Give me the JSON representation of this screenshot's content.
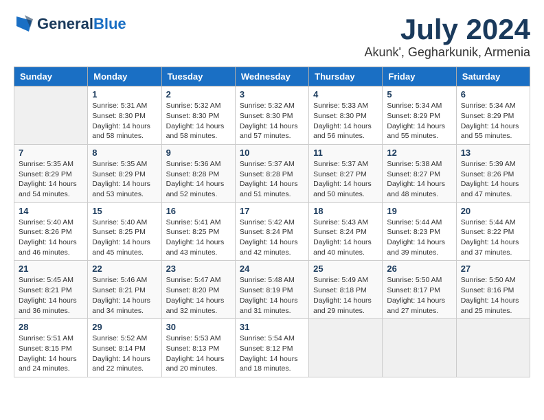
{
  "header": {
    "logo_general": "General",
    "logo_blue": "Blue",
    "month": "July 2024",
    "location": "Akunk', Gegharkunik, Armenia"
  },
  "weekdays": [
    "Sunday",
    "Monday",
    "Tuesday",
    "Wednesday",
    "Thursday",
    "Friday",
    "Saturday"
  ],
  "weeks": [
    [
      {
        "day": "",
        "sunrise": "",
        "sunset": "",
        "daylight": ""
      },
      {
        "day": "1",
        "sunrise": "Sunrise: 5:31 AM",
        "sunset": "Sunset: 8:30 PM",
        "daylight": "Daylight: 14 hours and 58 minutes."
      },
      {
        "day": "2",
        "sunrise": "Sunrise: 5:32 AM",
        "sunset": "Sunset: 8:30 PM",
        "daylight": "Daylight: 14 hours and 58 minutes."
      },
      {
        "day": "3",
        "sunrise": "Sunrise: 5:32 AM",
        "sunset": "Sunset: 8:30 PM",
        "daylight": "Daylight: 14 hours and 57 minutes."
      },
      {
        "day": "4",
        "sunrise": "Sunrise: 5:33 AM",
        "sunset": "Sunset: 8:30 PM",
        "daylight": "Daylight: 14 hours and 56 minutes."
      },
      {
        "day": "5",
        "sunrise": "Sunrise: 5:34 AM",
        "sunset": "Sunset: 8:29 PM",
        "daylight": "Daylight: 14 hours and 55 minutes."
      },
      {
        "day": "6",
        "sunrise": "Sunrise: 5:34 AM",
        "sunset": "Sunset: 8:29 PM",
        "daylight": "Daylight: 14 hours and 55 minutes."
      }
    ],
    [
      {
        "day": "7",
        "sunrise": "Sunrise: 5:35 AM",
        "sunset": "Sunset: 8:29 PM",
        "daylight": "Daylight: 14 hours and 54 minutes."
      },
      {
        "day": "8",
        "sunrise": "Sunrise: 5:35 AM",
        "sunset": "Sunset: 8:29 PM",
        "daylight": "Daylight: 14 hours and 53 minutes."
      },
      {
        "day": "9",
        "sunrise": "Sunrise: 5:36 AM",
        "sunset": "Sunset: 8:28 PM",
        "daylight": "Daylight: 14 hours and 52 minutes."
      },
      {
        "day": "10",
        "sunrise": "Sunrise: 5:37 AM",
        "sunset": "Sunset: 8:28 PM",
        "daylight": "Daylight: 14 hours and 51 minutes."
      },
      {
        "day": "11",
        "sunrise": "Sunrise: 5:37 AM",
        "sunset": "Sunset: 8:27 PM",
        "daylight": "Daylight: 14 hours and 50 minutes."
      },
      {
        "day": "12",
        "sunrise": "Sunrise: 5:38 AM",
        "sunset": "Sunset: 8:27 PM",
        "daylight": "Daylight: 14 hours and 48 minutes."
      },
      {
        "day": "13",
        "sunrise": "Sunrise: 5:39 AM",
        "sunset": "Sunset: 8:26 PM",
        "daylight": "Daylight: 14 hours and 47 minutes."
      }
    ],
    [
      {
        "day": "14",
        "sunrise": "Sunrise: 5:40 AM",
        "sunset": "Sunset: 8:26 PM",
        "daylight": "Daylight: 14 hours and 46 minutes."
      },
      {
        "day": "15",
        "sunrise": "Sunrise: 5:40 AM",
        "sunset": "Sunset: 8:25 PM",
        "daylight": "Daylight: 14 hours and 45 minutes."
      },
      {
        "day": "16",
        "sunrise": "Sunrise: 5:41 AM",
        "sunset": "Sunset: 8:25 PM",
        "daylight": "Daylight: 14 hours and 43 minutes."
      },
      {
        "day": "17",
        "sunrise": "Sunrise: 5:42 AM",
        "sunset": "Sunset: 8:24 PM",
        "daylight": "Daylight: 14 hours and 42 minutes."
      },
      {
        "day": "18",
        "sunrise": "Sunrise: 5:43 AM",
        "sunset": "Sunset: 8:24 PM",
        "daylight": "Daylight: 14 hours and 40 minutes."
      },
      {
        "day": "19",
        "sunrise": "Sunrise: 5:44 AM",
        "sunset": "Sunset: 8:23 PM",
        "daylight": "Daylight: 14 hours and 39 minutes."
      },
      {
        "day": "20",
        "sunrise": "Sunrise: 5:44 AM",
        "sunset": "Sunset: 8:22 PM",
        "daylight": "Daylight: 14 hours and 37 minutes."
      }
    ],
    [
      {
        "day": "21",
        "sunrise": "Sunrise: 5:45 AM",
        "sunset": "Sunset: 8:21 PM",
        "daylight": "Daylight: 14 hours and 36 minutes."
      },
      {
        "day": "22",
        "sunrise": "Sunrise: 5:46 AM",
        "sunset": "Sunset: 8:21 PM",
        "daylight": "Daylight: 14 hours and 34 minutes."
      },
      {
        "day": "23",
        "sunrise": "Sunrise: 5:47 AM",
        "sunset": "Sunset: 8:20 PM",
        "daylight": "Daylight: 14 hours and 32 minutes."
      },
      {
        "day": "24",
        "sunrise": "Sunrise: 5:48 AM",
        "sunset": "Sunset: 8:19 PM",
        "daylight": "Daylight: 14 hours and 31 minutes."
      },
      {
        "day": "25",
        "sunrise": "Sunrise: 5:49 AM",
        "sunset": "Sunset: 8:18 PM",
        "daylight": "Daylight: 14 hours and 29 minutes."
      },
      {
        "day": "26",
        "sunrise": "Sunrise: 5:50 AM",
        "sunset": "Sunset: 8:17 PM",
        "daylight": "Daylight: 14 hours and 27 minutes."
      },
      {
        "day": "27",
        "sunrise": "Sunrise: 5:50 AM",
        "sunset": "Sunset: 8:16 PM",
        "daylight": "Daylight: 14 hours and 25 minutes."
      }
    ],
    [
      {
        "day": "28",
        "sunrise": "Sunrise: 5:51 AM",
        "sunset": "Sunset: 8:15 PM",
        "daylight": "Daylight: 14 hours and 24 minutes."
      },
      {
        "day": "29",
        "sunrise": "Sunrise: 5:52 AM",
        "sunset": "Sunset: 8:14 PM",
        "daylight": "Daylight: 14 hours and 22 minutes."
      },
      {
        "day": "30",
        "sunrise": "Sunrise: 5:53 AM",
        "sunset": "Sunset: 8:13 PM",
        "daylight": "Daylight: 14 hours and 20 minutes."
      },
      {
        "day": "31",
        "sunrise": "Sunrise: 5:54 AM",
        "sunset": "Sunset: 8:12 PM",
        "daylight": "Daylight: 14 hours and 18 minutes."
      },
      {
        "day": "",
        "sunrise": "",
        "sunset": "",
        "daylight": ""
      },
      {
        "day": "",
        "sunrise": "",
        "sunset": "",
        "daylight": ""
      },
      {
        "day": "",
        "sunrise": "",
        "sunset": "",
        "daylight": ""
      }
    ]
  ]
}
